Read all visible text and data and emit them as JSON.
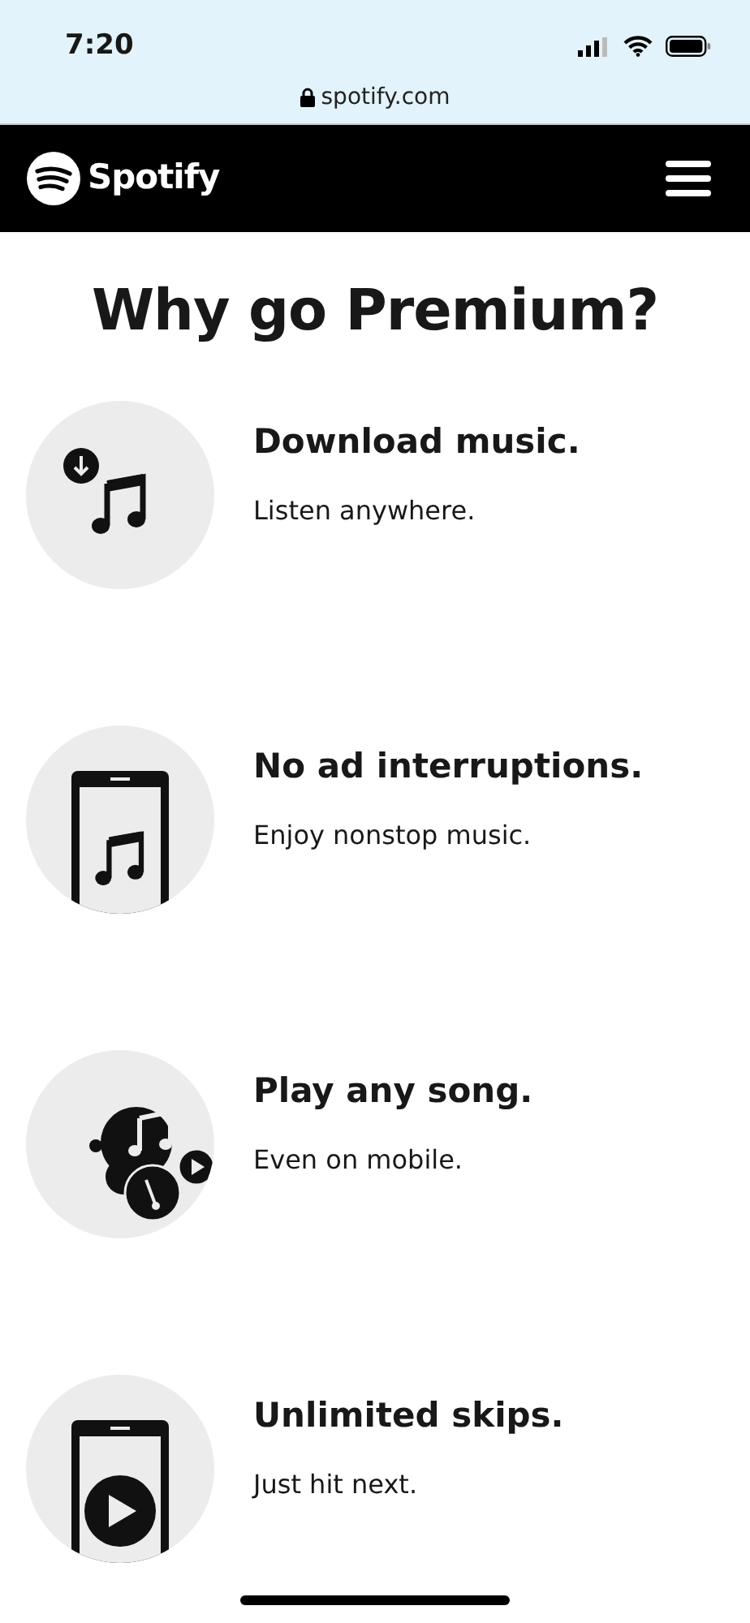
{
  "status_bar": {
    "time": "7:20"
  },
  "address_bar": {
    "url": "spotify.com"
  },
  "navbar": {
    "brand": "Spotify"
  },
  "heading": "Why go Premium?",
  "features": [
    {
      "kind": "download",
      "title": "Download music.",
      "subtitle": "Listen anywhere."
    },
    {
      "kind": "no-ads",
      "title": "No ad interruptions.",
      "subtitle": "Enjoy nonstop music."
    },
    {
      "kind": "any-song",
      "title": "Play any song.",
      "subtitle": "Even on mobile."
    },
    {
      "kind": "skips",
      "title": "Unlimited skips.",
      "subtitle": "Just hit next."
    }
  ]
}
